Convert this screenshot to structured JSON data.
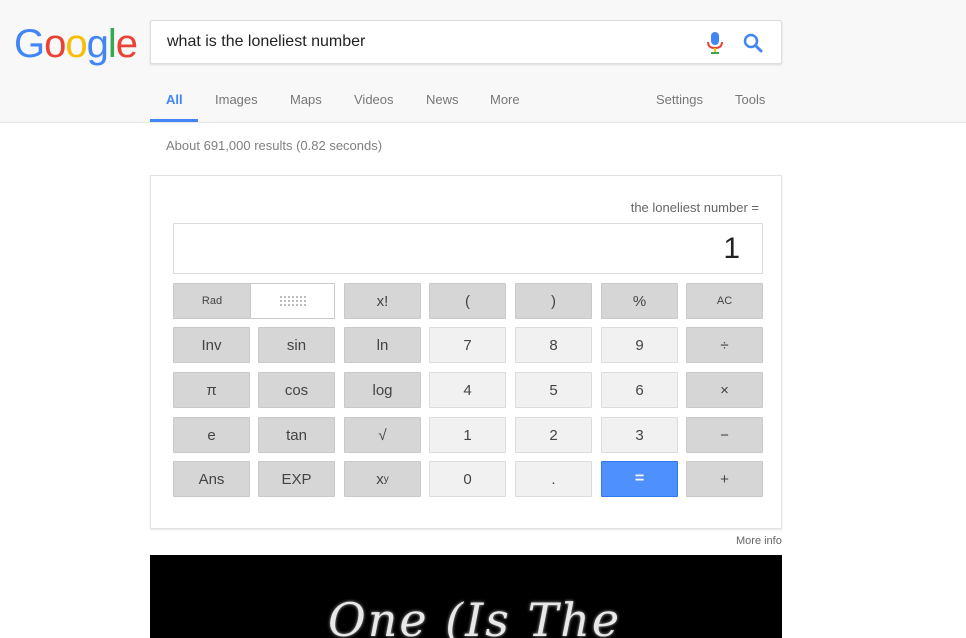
{
  "logo": {
    "letters": [
      "G",
      "o",
      "o",
      "g",
      "l",
      "e"
    ]
  },
  "search": {
    "query": "what is the loneliest number"
  },
  "tabs": [
    {
      "label": "All",
      "active": true
    },
    {
      "label": "Images"
    },
    {
      "label": "Maps"
    },
    {
      "label": "Videos"
    },
    {
      "label": "News"
    },
    {
      "label": "More"
    },
    {
      "label": "Settings"
    },
    {
      "label": "Tools"
    }
  ],
  "results_stats": "About 691,000 results (0.82 seconds)",
  "calculator": {
    "expression": "the loneliest number =",
    "display": "1",
    "mode_rad": "Rad",
    "keys": {
      "fact": "x!",
      "lparen": "(",
      "rparen": ")",
      "pct": "%",
      "ac": "AC",
      "inv": "Inv",
      "sin": "sin",
      "ln": "ln",
      "n7": "7",
      "n8": "8",
      "n9": "9",
      "div": "÷",
      "pi": "π",
      "cos": "cos",
      "log": "log",
      "n4": "4",
      "n5": "5",
      "n6": "6",
      "mul": "×",
      "e": "e",
      "tan": "tan",
      "sqrt": "√",
      "n1": "1",
      "n2": "2",
      "n3": "3",
      "sub": "−",
      "ans": "Ans",
      "exp": "EXP",
      "pow_base": "x",
      "pow_sup": "y",
      "n0": "0",
      "dot": ".",
      "eq": "=",
      "add": "+"
    }
  },
  "more_info": "More info",
  "video": {
    "title_text": "One (Is The"
  },
  "colors": {
    "accent": "#4285f4",
    "equals_button": "#4d90fe"
  }
}
